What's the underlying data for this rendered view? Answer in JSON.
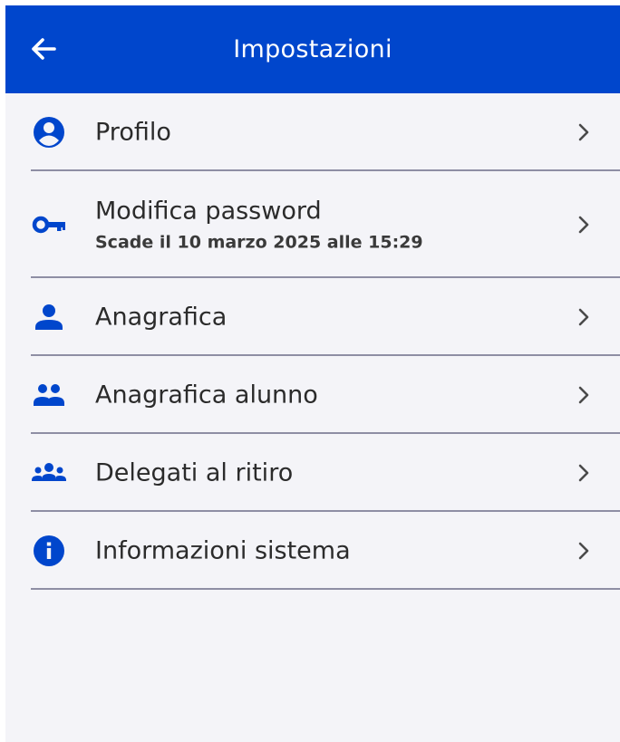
{
  "header": {
    "title": "Impostazioni",
    "back_icon": "arrow-left-icon",
    "bg": "#0046cc"
  },
  "accent": "#0046cc",
  "items": [
    {
      "label": "Profilo",
      "icon": "account-circle-icon"
    },
    {
      "label": "Modifica password",
      "sublabel": "Scade il 10 marzo 2025 alle 15:29",
      "icon": "key-icon"
    },
    {
      "label": "Anagrafica",
      "icon": "person-icon"
    },
    {
      "label": "Anagrafica alunno",
      "icon": "people-icon"
    },
    {
      "label": "Delegati al ritiro",
      "icon": "groups-icon"
    },
    {
      "label": "Informazioni sistema",
      "icon": "info-icon"
    }
  ]
}
